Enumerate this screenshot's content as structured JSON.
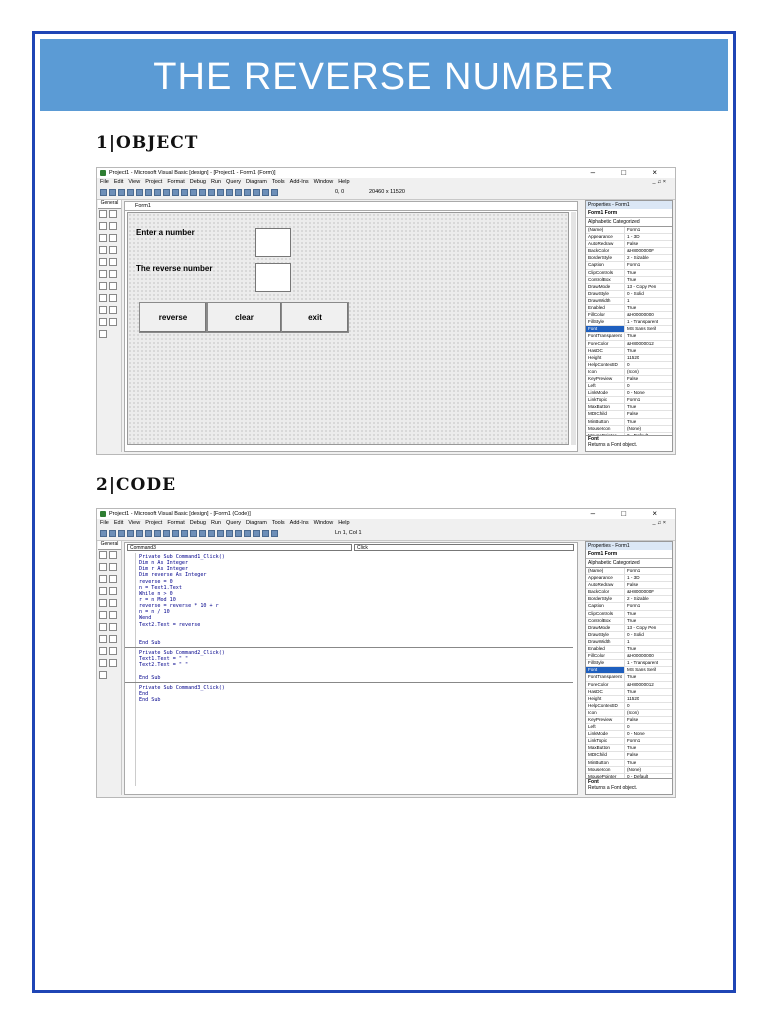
{
  "title": "THE REVERSE NUMBER",
  "sections": {
    "object_heading": "1|OBJECT",
    "code_heading": "2|CODE"
  },
  "ide": {
    "window_title_design": "Project1 - Microsoft Visual Basic [design] - [Project1 - Form1 (Form)]",
    "window_title_code": "Project1 - Microsoft Visual Basic [design] - [Form1 (Code)]",
    "window_controls": "– □ ×",
    "mdi_controls": "_ ♫ ×",
    "menu": [
      "File",
      "Edit",
      "View",
      "Project",
      "Format",
      "Debug",
      "Run",
      "Query",
      "Diagram",
      "Tools",
      "Add-Ins",
      "Window",
      "Help"
    ],
    "toolbar_position": "0, 0",
    "toolbar_size": "20460 x 11520",
    "toolbar_cursor": "Ln 1, Col 1",
    "toolbox_label": "General",
    "toolbox_close": "×"
  },
  "form_designer": {
    "form_caption": "Form1",
    "label_enter": "Enter a number",
    "label_reverse": "The reverse number",
    "buttons": [
      "reverse",
      "clear",
      "exit"
    ]
  },
  "properties": {
    "header": "Properties - Form1",
    "object": "Form1  Form",
    "tabs": "Alphabetic  Categorized",
    "rows": [
      [
        "(Name)",
        "Form1"
      ],
      [
        "Appearance",
        "1 - 3D"
      ],
      [
        "AutoRedraw",
        "False"
      ],
      [
        "BackColor",
        "&H8000000F"
      ],
      [
        "BorderStyle",
        "2 - Sizable"
      ],
      [
        "Caption",
        "Form1"
      ],
      [
        "ClipControls",
        "True"
      ],
      [
        "ControlBox",
        "True"
      ],
      [
        "DrawMode",
        "13 - Copy Pen"
      ],
      [
        "DrawStyle",
        "0 - Solid"
      ],
      [
        "DrawWidth",
        "1"
      ],
      [
        "Enabled",
        "True"
      ],
      [
        "FillColor",
        "&H00000000"
      ],
      [
        "FillStyle",
        "1 - Transparent"
      ],
      [
        "Font",
        "MS Sans Serif"
      ],
      [
        "FontTransparent",
        "True"
      ],
      [
        "ForeColor",
        "&H80000012"
      ],
      [
        "HasDC",
        "True"
      ],
      [
        "Height",
        "11520"
      ],
      [
        "HelpContextID",
        "0"
      ],
      [
        "Icon",
        "(Icon)"
      ],
      [
        "KeyPreview",
        "False"
      ],
      [
        "Left",
        "0"
      ],
      [
        "LinkMode",
        "0 - None"
      ],
      [
        "LinkTopic",
        "Form1"
      ],
      [
        "MaxButton",
        "True"
      ],
      [
        "MDIChild",
        "False"
      ],
      [
        "MinButton",
        "True"
      ],
      [
        "MouseIcon",
        "(None)"
      ],
      [
        "MousePointer",
        "0 - Default"
      ],
      [
        "Moveable",
        "True"
      ],
      [
        "NegotiateMenus",
        "True"
      ]
    ],
    "selected_row": 14,
    "footer_title": "Font",
    "footer_desc": "Returns a Font object."
  },
  "code_editor": {
    "object_combo": "Command3",
    "proc_combo": "Click",
    "procedures": [
      [
        "Private Sub Command1_Click()",
        "Dim n As Integer",
        "Dim r As Integer",
        "Dim reverse As Integer",
        "reverse = 0",
        "n = Text1.Text",
        "While n > 0",
        "r = n Mod 10",
        "reverse = reverse * 10 + r",
        "n = n / 10",
        "Wend",
        "Text2.Text = reverse",
        "",
        "",
        "End Sub"
      ],
      [
        "Private Sub Command2_Click()",
        "Text1.Text = \" \"",
        "Text2.Text = \" \"",
        "",
        "End Sub"
      ],
      [
        "Private Sub Command3_Click()",
        "End",
        "End Sub"
      ]
    ]
  },
  "colors": {
    "title_bar": "#5b9bd5",
    "page_border": "#1f45b5",
    "code_text": "#00008b",
    "selection": "#1e5fbf"
  }
}
